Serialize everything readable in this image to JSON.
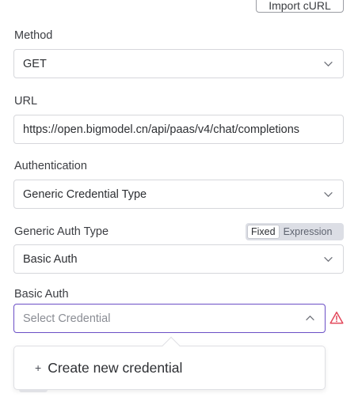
{
  "import_button": {
    "label": "Import cURL"
  },
  "method": {
    "label": "Method",
    "value": "GET"
  },
  "url": {
    "label": "URL",
    "value": "https://open.bigmodel.cn/api/paas/v4/chat/completions"
  },
  "authentication": {
    "label": "Authentication",
    "value": "Generic Credential Type"
  },
  "generic_auth_type": {
    "label": "Generic Auth Type",
    "value": "Basic Auth",
    "toggle": {
      "fixed": "Fixed",
      "expression": "Expression",
      "selected": "Fixed"
    }
  },
  "basic_auth": {
    "label": "Basic Auth",
    "placeholder": "Select Credential",
    "status_icon": "warning-triangle-icon",
    "dropdown": {
      "plus": "+",
      "create_label": "Create new credential"
    }
  },
  "colors": {
    "accent": "#6b4fc6",
    "warning": "#e2475a",
    "border": "#d6d7db"
  }
}
